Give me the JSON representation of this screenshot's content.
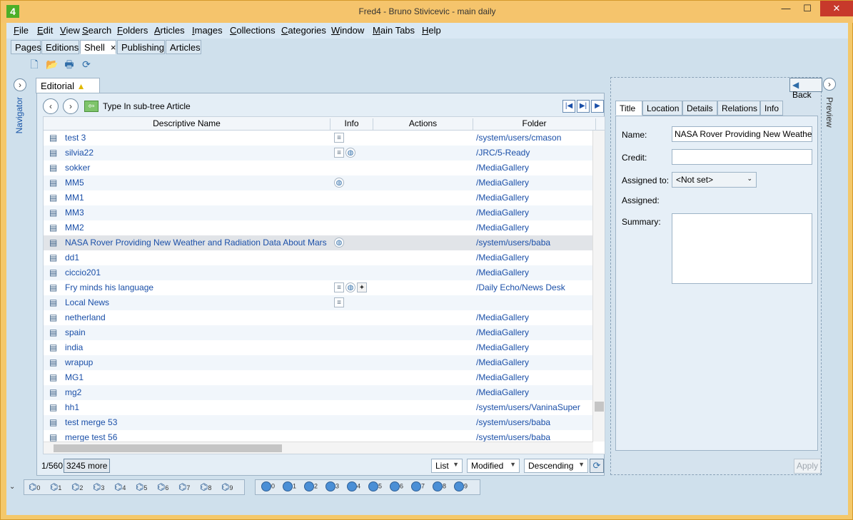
{
  "window": {
    "title": "Fred4 - Bruno Stivicevic - main daily",
    "app_icon": "4",
    "minimize": "—",
    "maximize": "☐",
    "close": "✕"
  },
  "menu": [
    {
      "label": "File",
      "u": "F",
      "rest": "ile"
    },
    {
      "label": "Edit",
      "u": "E",
      "rest": "dit"
    },
    {
      "label": "View",
      "u": "V",
      "rest": "iew"
    },
    {
      "label": "Search",
      "u": "S",
      "rest": "earch"
    },
    {
      "label": "Folders",
      "u": "F",
      "rest": "olders"
    },
    {
      "label": "Articles",
      "u": "A",
      "rest": "rticles"
    },
    {
      "label": "Images",
      "u": "I",
      "rest": "mages"
    },
    {
      "label": "Collections",
      "u": "C",
      "rest": "ollections"
    },
    {
      "label": "Categories",
      "u": "C",
      "rest": "ategories"
    },
    {
      "label": "Window",
      "u": "W",
      "rest": "indow"
    },
    {
      "label": "Main Tabs",
      "u": "M",
      "rest": "ain Tabs"
    },
    {
      "label": "Help",
      "u": "H",
      "rest": "elp"
    }
  ],
  "main_tabs": [
    "Pages",
    "Editions",
    "Shell",
    "Publishing",
    "Articles"
  ],
  "main_tab_close": "×",
  "navigator_label": "Navigator",
  "preview_label": "Preview",
  "editorial": {
    "tab_label": "Editorial",
    "tab_close": "×",
    "nav_title": "Type In sub-tree Article",
    "columns": [
      "Descriptive Name",
      "Info",
      "Actions",
      "Folder"
    ],
    "rows": [
      {
        "name": "test 3",
        "icons": [
          "doc"
        ],
        "folder": "/system/users/cmason"
      },
      {
        "name": "silvia22",
        "icons": [
          "doc",
          "globe"
        ],
        "folder": "/JRC/5-Ready"
      },
      {
        "name": "sokker",
        "icons": [],
        "folder": "/MediaGallery"
      },
      {
        "name": "MM5",
        "icons": [
          "globe"
        ],
        "folder": "/MediaGallery"
      },
      {
        "name": "MM1",
        "icons": [],
        "folder": "/MediaGallery"
      },
      {
        "name": "MM3",
        "icons": [],
        "folder": "/MediaGallery"
      },
      {
        "name": "MM2",
        "icons": [],
        "folder": "/MediaGallery"
      },
      {
        "name": "NASA Rover Providing New Weather and Radiation Data About Mars",
        "icons": [
          "globe"
        ],
        "folder": "/system/users/baba",
        "selected": true
      },
      {
        "name": "dd1",
        "icons": [],
        "folder": "/MediaGallery"
      },
      {
        "name": "ciccio201",
        "icons": [],
        "folder": "/MediaGallery"
      },
      {
        "name": "Fry minds his language",
        "icons": [
          "doc",
          "globe",
          "dark"
        ],
        "folder": "/Daily Echo/News Desk"
      },
      {
        "name": "Local News",
        "icons": [
          "doc"
        ],
        "folder": ""
      },
      {
        "name": "netherland",
        "icons": [],
        "folder": "/MediaGallery"
      },
      {
        "name": "spain",
        "icons": [],
        "folder": "/MediaGallery"
      },
      {
        "name": "india",
        "icons": [],
        "folder": "/MediaGallery"
      },
      {
        "name": "wrapup",
        "icons": [],
        "folder": "/MediaGallery"
      },
      {
        "name": "MG1",
        "icons": [],
        "folder": "/MediaGallery"
      },
      {
        "name": "mg2",
        "icons": [],
        "folder": "/MediaGallery"
      },
      {
        "name": "hh1",
        "icons": [],
        "folder": "/system/users/VaninaSuper"
      },
      {
        "name": "test merge 53",
        "icons": [],
        "folder": "/system/users/baba"
      },
      {
        "name": "merge test 56",
        "icons": [],
        "folder": "/system/users/baba"
      }
    ],
    "count": "1/560",
    "more": "3245 more",
    "view_mode": "List",
    "sort_field": "Modified",
    "sort_order": "Descending"
  },
  "detail": {
    "back": "Back",
    "tabs": [
      "Title",
      "Location",
      "Details",
      "Relations",
      "Info"
    ],
    "name_label": "Name:",
    "name_value": "NASA Rover Providing New Weather",
    "credit_label": "Credit:",
    "credit_value": "",
    "assigned_to_label": "Assigned to:",
    "assigned_to_value": "<Not set>",
    "assigned_label": "Assigned:",
    "summary_label": "Summary:",
    "apply": "Apply"
  },
  "bottom": {
    "binoculars": [
      "0",
      "1",
      "2",
      "3",
      "4",
      "5",
      "6",
      "7",
      "8",
      "9"
    ],
    "globes": [
      "0",
      "1",
      "2",
      "3",
      "4",
      "5",
      "6",
      "7",
      "8",
      "9"
    ]
  }
}
